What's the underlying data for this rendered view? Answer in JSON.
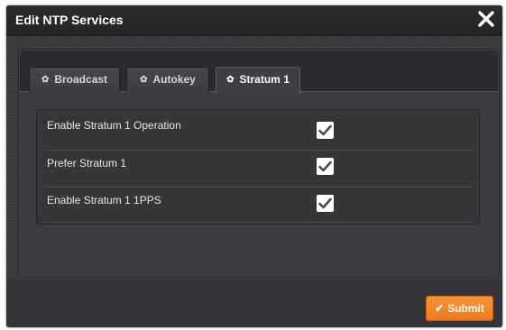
{
  "dialog": {
    "title": "Edit NTP Services",
    "close_icon": "close-icon"
  },
  "tabs": [
    {
      "label": "Broadcast",
      "icon": "gear-icon",
      "active": false
    },
    {
      "label": "Autokey",
      "icon": "gear-icon",
      "active": false
    },
    {
      "label": "Stratum 1",
      "icon": "gear-icon",
      "active": true
    }
  ],
  "settings": [
    {
      "label": "Enable Stratum 1 Operation",
      "checked": true
    },
    {
      "label": "Prefer Stratum 1",
      "checked": true
    },
    {
      "label": "Enable Stratum 1 1PPS",
      "checked": true
    }
  ],
  "footer": {
    "submit_label": "Submit",
    "submit_icon": "check-icon"
  },
  "colors": {
    "accent": "#f08a2a",
    "background": "#36373a",
    "titlebar": "#232426"
  }
}
